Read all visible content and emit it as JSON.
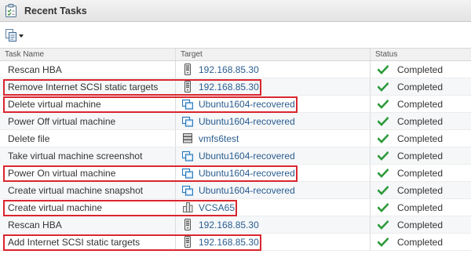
{
  "panel": {
    "title": "Recent Tasks",
    "title_icon": "tasks-clipboard-icon"
  },
  "toolbar": {
    "action_icon": "copy-document-icon",
    "dropdown_icon": "chevron-down-icon"
  },
  "columns": {
    "task_name": "Task Name",
    "target": "Target",
    "status": "Status"
  },
  "colors": {
    "link": "#2a5d8f",
    "status_check": "#2e9a3b",
    "highlight": "#d9262f"
  },
  "rows": [
    {
      "task": "Rescan HBA",
      "target": "192.168.85.30",
      "target_icon": "host-server-icon",
      "status": "Completed",
      "status_icon": "check-icon",
      "highlighted": false
    },
    {
      "task": "Remove Internet SCSI static targets",
      "target": "192.168.85.30",
      "target_icon": "host-server-icon",
      "status": "Completed",
      "status_icon": "check-icon",
      "highlighted": true
    },
    {
      "task": "Delete virtual machine",
      "target": "Ubuntu1604-recovered",
      "target_icon": "virtual-machine-icon",
      "status": "Completed",
      "status_icon": "check-icon",
      "highlighted": true
    },
    {
      "task": "Power Off virtual machine",
      "target": "Ubuntu1604-recovered",
      "target_icon": "virtual-machine-icon",
      "status": "Completed",
      "status_icon": "check-icon",
      "highlighted": false
    },
    {
      "task": "Delete file",
      "target": "vmfs6test",
      "target_icon": "datastore-icon",
      "status": "Completed",
      "status_icon": "check-icon",
      "highlighted": false
    },
    {
      "task": "Take virtual machine screenshot",
      "target": "Ubuntu1604-recovered",
      "target_icon": "virtual-machine-icon",
      "status": "Completed",
      "status_icon": "check-icon",
      "highlighted": false
    },
    {
      "task": "Power On virtual machine",
      "target": "Ubuntu1604-recovered",
      "target_icon": "virtual-machine-icon",
      "status": "Completed",
      "status_icon": "check-icon",
      "highlighted": true
    },
    {
      "task": "Create virtual machine snapshot",
      "target": "Ubuntu1604-recovered",
      "target_icon": "virtual-machine-icon",
      "status": "Completed",
      "status_icon": "check-icon",
      "highlighted": false
    },
    {
      "task": "Create virtual machine",
      "target": "VCSA65",
      "target_icon": "vm-folder-icon",
      "status": "Completed",
      "status_icon": "check-icon",
      "highlighted": true
    },
    {
      "task": "Rescan HBA",
      "target": "192.168.85.30",
      "target_icon": "host-server-icon",
      "status": "Completed",
      "status_icon": "check-icon",
      "highlighted": false
    },
    {
      "task": "Add Internet SCSI static targets",
      "target": "192.168.85.30",
      "target_icon": "host-server-icon",
      "status": "Completed",
      "status_icon": "check-icon",
      "highlighted": true
    }
  ]
}
